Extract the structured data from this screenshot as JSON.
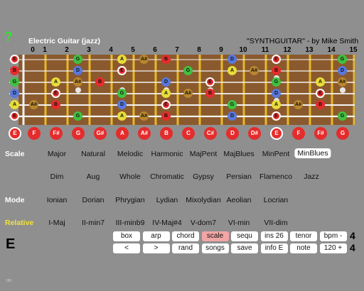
{
  "header": {
    "help_label": "?",
    "instrument": "Electric Guitar (jazz)",
    "credit": "\"SYNTHGUITAR\" - by Mike Smith"
  },
  "fret_numbers": [
    "0",
    "1",
    "2",
    "3",
    "4",
    "5",
    "6",
    "7",
    "8",
    "9",
    "10",
    "11",
    "12",
    "13",
    "14",
    "15"
  ],
  "string_names": [
    "E",
    "B",
    "G",
    "D",
    "A",
    "E"
  ],
  "note_colors": {
    "red": "#e52c2c",
    "green": "#40c040",
    "yellow": "#e8dc3a",
    "blue": "#5878dc",
    "brown": "#b8862e"
  },
  "fretboard_notes": [
    {
      "string": 0,
      "fret": 0,
      "label": "E",
      "color": "red",
      "root": true
    },
    {
      "string": 0,
      "fret": 3,
      "label": "G",
      "color": "green",
      "root": false
    },
    {
      "string": 0,
      "fret": 5,
      "label": "A",
      "color": "yellow",
      "root": false
    },
    {
      "string": 0,
      "fret": 6,
      "label": "A#",
      "color": "brown",
      "root": false
    },
    {
      "string": 0,
      "fret": 7,
      "label": "B",
      "color": "red",
      "root": false
    },
    {
      "string": 0,
      "fret": 10,
      "label": "D",
      "color": "blue",
      "root": false
    },
    {
      "string": 0,
      "fret": 12,
      "label": "E",
      "color": "red",
      "root": true
    },
    {
      "string": 0,
      "fret": 15,
      "label": "G",
      "color": "green",
      "root": false
    },
    {
      "string": 1,
      "fret": 0,
      "label": "B",
      "color": "red",
      "root": false
    },
    {
      "string": 1,
      "fret": 3,
      "label": "D",
      "color": "blue",
      "root": false
    },
    {
      "string": 1,
      "fret": 5,
      "label": "E",
      "color": "red",
      "root": true
    },
    {
      "string": 1,
      "fret": 8,
      "label": "G",
      "color": "green",
      "root": false
    },
    {
      "string": 1,
      "fret": 10,
      "label": "A",
      "color": "yellow",
      "root": false
    },
    {
      "string": 1,
      "fret": 11,
      "label": "A#",
      "color": "brown",
      "root": false
    },
    {
      "string": 1,
      "fret": 12,
      "label": "B",
      "color": "red",
      "root": false
    },
    {
      "string": 1,
      "fret": 15,
      "label": "D",
      "color": "blue",
      "root": false
    },
    {
      "string": 2,
      "fret": 0,
      "label": "G",
      "color": "green",
      "root": false
    },
    {
      "string": 2,
      "fret": 2,
      "label": "A",
      "color": "yellow",
      "root": false
    },
    {
      "string": 2,
      "fret": 3,
      "label": "A#",
      "color": "brown",
      "root": false
    },
    {
      "string": 2,
      "fret": 4,
      "label": "B",
      "color": "red",
      "root": false
    },
    {
      "string": 2,
      "fret": 7,
      "label": "D",
      "color": "blue",
      "root": false
    },
    {
      "string": 2,
      "fret": 9,
      "label": "E",
      "color": "red",
      "root": true
    },
    {
      "string": 2,
      "fret": 12,
      "label": "G",
      "color": "green",
      "root": false
    },
    {
      "string": 2,
      "fret": 14,
      "label": "A",
      "color": "yellow",
      "root": false
    },
    {
      "string": 2,
      "fret": 15,
      "label": "A#",
      "color": "brown",
      "root": false
    },
    {
      "string": 3,
      "fret": 0,
      "label": "D",
      "color": "blue",
      "root": false
    },
    {
      "string": 3,
      "fret": 2,
      "label": "E",
      "color": "red",
      "root": true
    },
    {
      "string": 3,
      "fret": 5,
      "label": "G",
      "color": "green",
      "root": false
    },
    {
      "string": 3,
      "fret": 7,
      "label": "A",
      "color": "yellow",
      "root": false
    },
    {
      "string": 3,
      "fret": 8,
      "label": "A#",
      "color": "brown",
      "root": false
    },
    {
      "string": 3,
      "fret": 9,
      "label": "B",
      "color": "red",
      "root": false
    },
    {
      "string": 3,
      "fret": 12,
      "label": "D",
      "color": "blue",
      "root": false
    },
    {
      "string": 3,
      "fret": 14,
      "label": "E",
      "color": "red",
      "root": true
    },
    {
      "string": 4,
      "fret": 0,
      "label": "A",
      "color": "yellow",
      "root": false
    },
    {
      "string": 4,
      "fret": 1,
      "label": "A#",
      "color": "brown",
      "root": false
    },
    {
      "string": 4,
      "fret": 2,
      "label": "B",
      "color": "red",
      "root": false
    },
    {
      "string": 4,
      "fret": 5,
      "label": "D",
      "color": "blue",
      "root": false
    },
    {
      "string": 4,
      "fret": 7,
      "label": "E",
      "color": "red",
      "root": true
    },
    {
      "string": 4,
      "fret": 10,
      "label": "G",
      "color": "green",
      "root": false
    },
    {
      "string": 4,
      "fret": 12,
      "label": "A",
      "color": "yellow",
      "root": false
    },
    {
      "string": 4,
      "fret": 13,
      "label": "A#",
      "color": "brown",
      "root": false
    },
    {
      "string": 4,
      "fret": 14,
      "label": "B",
      "color": "red",
      "root": false
    },
    {
      "string": 5,
      "fret": 0,
      "label": "E",
      "color": "red",
      "root": true
    },
    {
      "string": 5,
      "fret": 3,
      "label": "G",
      "color": "green",
      "root": false
    },
    {
      "string": 5,
      "fret": 5,
      "label": "A",
      "color": "yellow",
      "root": false
    },
    {
      "string": 5,
      "fret": 6,
      "label": "A#",
      "color": "brown",
      "root": false
    },
    {
      "string": 5,
      "fret": 7,
      "label": "B",
      "color": "red",
      "root": false
    },
    {
      "string": 5,
      "fret": 10,
      "label": "D",
      "color": "blue",
      "root": false
    },
    {
      "string": 5,
      "fret": 12,
      "label": "E",
      "color": "red",
      "root": true
    },
    {
      "string": 5,
      "fret": 15,
      "label": "G",
      "color": "green",
      "root": false
    }
  ],
  "key_selector": [
    "E",
    "F",
    "F#",
    "G",
    "G#",
    "A",
    "A#",
    "B",
    "C",
    "C#",
    "D",
    "D#",
    "E",
    "F",
    "F#",
    "G"
  ],
  "labels": {
    "scale": "Scale",
    "mode": "Mode",
    "relative": "Relative"
  },
  "scales_row1": [
    "Major",
    "Natural",
    "Melodic",
    "Harmonic",
    "MajPent",
    "MajBlues",
    "MinPent",
    "MinBlues"
  ],
  "scales_row2": [
    "Dim",
    "Aug",
    "Whole",
    "Chromatic",
    "Gypsy",
    "Persian",
    "Flamenco",
    "Jazz"
  ],
  "modes": [
    "Ionian",
    "Dorian",
    "Phrygian",
    "Lydian",
    "Mixolydian",
    "Aeolian",
    "Locrian"
  ],
  "relatives": [
    "I-Maj",
    "II-min7",
    "III-minb9",
    "IV-Maj#4",
    "V-dom7",
    "VI-min",
    "VII-dim"
  ],
  "selected_scale": "MinBlues",
  "current_key": "E",
  "buttons_row1": [
    {
      "label": "box",
      "active": false
    },
    {
      "label": "arp",
      "active": false
    },
    {
      "label": "chord",
      "active": false
    },
    {
      "label": "scale",
      "active": true
    },
    {
      "label": "sequ",
      "active": false
    },
    {
      "label": "ins 26",
      "active": false
    },
    {
      "label": "tenor",
      "active": false
    },
    {
      "label": "bpm -",
      "active": false
    }
  ],
  "buttons_row2": [
    {
      "label": "<",
      "active": false
    },
    {
      "label": ">",
      "active": false
    },
    {
      "label": "rand",
      "active": false
    },
    {
      "label": "songs",
      "active": false
    },
    {
      "label": "save",
      "active": false
    },
    {
      "label": "info E",
      "active": false
    },
    {
      "label": "note",
      "active": false
    },
    {
      "label": "120 +",
      "active": false
    }
  ],
  "time_signature": {
    "top": "4",
    "bottom": "4"
  },
  "footer_text": "180"
}
